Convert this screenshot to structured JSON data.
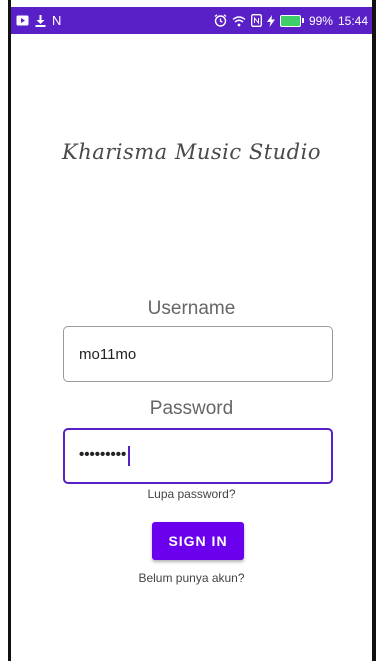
{
  "status_bar": {
    "background": "#5a20c8",
    "left_icons": [
      "notification-square-icon",
      "download-icon",
      "n-icon"
    ],
    "n_glyph": "N",
    "right_icons": [
      "alarm-icon",
      "wifi-icon",
      "nfc-icon",
      "charging-icon",
      "battery-icon"
    ],
    "battery_percent": "99%",
    "time": "15:44"
  },
  "app": {
    "title": "Kharisma Music Studio"
  },
  "form": {
    "username_label": "Username",
    "username_value": "mo11mo",
    "password_label": "Password",
    "password_mask": "•••••••••",
    "forgot_label": "Lupa password?",
    "signin_label": "SIGN IN",
    "register_label": "Belum punya akun?"
  },
  "colors": {
    "accent": "#6a00ee",
    "focus_border": "#5a20c8",
    "battery": "#3ecf6a"
  }
}
